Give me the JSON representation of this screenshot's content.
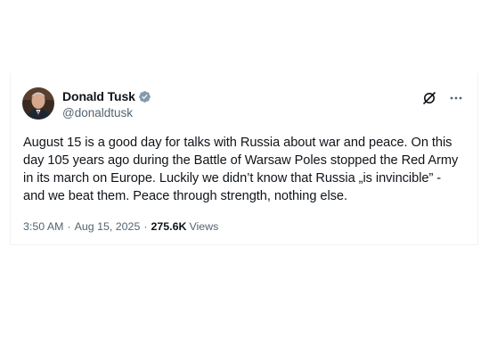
{
  "tweet": {
    "author": {
      "display_name": "Donald Tusk",
      "handle": "@donaldtusk",
      "verified": true
    },
    "text": "August 15 is a good day for talks with Russia about war and peace. On this day 105 years ago during the Battle of Warsaw Poles stopped the Red Army in its march on Europe. Luckily we didn’t know that Russia „is invincible” - and we beat them. Peace through strength, nothing else.",
    "time": "3:50 AM",
    "separator": "·",
    "date": "Aug 15, 2025",
    "separator2": "·",
    "views_count": "275.6K",
    "views_label": "Views"
  },
  "icons": {
    "verified": "verified-badge-icon",
    "grok": "grok-icon",
    "more": "more-options-icon"
  },
  "colors": {
    "text": "#0f1419",
    "secondary": "#536471",
    "verified_badge": "#829aab"
  }
}
